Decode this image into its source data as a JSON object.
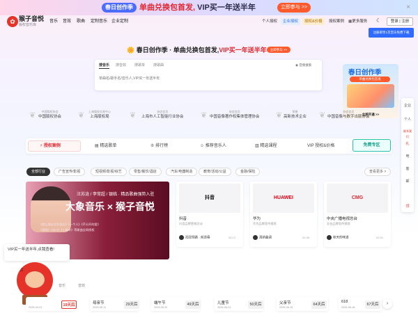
{
  "topbar": {
    "pill": "春日创作季",
    "main_red": "单曲兑换包首发,",
    "main_dark": "VIP买一年送半年",
    "btn": "立即参与 >>",
    "close": "×"
  },
  "nav": {
    "logo_title": "猴子音悦",
    "logo_sub": "版权音乐库",
    "links": [
      "音乐",
      "音效",
      "歌曲",
      "定制音乐",
      "企业定制"
    ],
    "right": [
      "个人授权",
      "企业授权",
      "授权&价格",
      "授权案例",
      "更多服务"
    ],
    "login": "登录 | 注册",
    "tooltip": "注册即享1次音乐免费下载"
  },
  "hero": {
    "title_a": "春日创作季 · 单曲兑换包首发,",
    "title_b": "VIP买一年送半年",
    "btn": "立即参与 >>"
  },
  "search": {
    "tabs": [
      "搜音乐",
      "搜音效",
      "搜歌单",
      "搜歌曲"
    ],
    "placeholder": "单曲名/歌手名/音乐人,VIP买一年送半年",
    "voice": "音频搜索"
  },
  "ad": {
    "title": "春日创作季",
    "sub": "单曲兑换包首发",
    "btn": "立即开通 >>"
  },
  "partners": [
    {
      "s": "中国版权协会",
      "m": "中国版权协会"
    },
    {
      "s": "上海版权交易中心",
      "m": "上海版权局"
    },
    {
      "s": "协会会员",
      "m": "上海市人工智能行业协会"
    },
    {
      "s": "协会会员",
      "m": "中国音像著作权集体管理协会"
    },
    {
      "s": "荣誉",
      "m": "高新技术企业"
    },
    {
      "s": "协会会员",
      "m": "中国音像与数字出版协会"
    }
  ],
  "features": [
    "授权案例",
    "精选歌单",
    "排行榜",
    "推荐音乐人",
    "精选课程",
    "VIP 授权&价格"
  ],
  "free_btn": "免费专区",
  "chips": [
    "全部行业",
    "广告宣传/影视",
    "短视频/影视/综艺",
    "零售/餐饮/酒店",
    "汽车/电器制造",
    "教育/活动/公益",
    "金融/保险"
  ],
  "more": "查看更多 >",
  "banner": {
    "t1": "汪苏泷 / 李常超 / 银临 · 精品歌曲强势入驻",
    "t2": "大象音乐 × 猴子音悦",
    "t3a": "《就让我走在你身边》《一个人》《不分开的爱》",
    "t3b": "《银临》《冰川》《小确幸》等歌曲全网授权"
  },
  "clients": [
    {
      "logo": "抖音",
      "name": "抖音",
      "sub": "抖音品牌营销活动",
      "play": "润润领路 · 前途春",
      "time": "00:13",
      "color": "#111"
    },
    {
      "logo": "HUAWEI",
      "name": "华为",
      "sub": "华为品牌宣传视频",
      "play": "清新曲调",
      "time": "00:38",
      "color": "#e60012"
    },
    {
      "logo": "CMG",
      "name": "中央广播电视总台",
      "sub": "总台品牌宣传视频",
      "play": "秋天的味道",
      "time": "02:51",
      "color": "#d7282f"
    }
  ],
  "rtools": [
    "企业",
    "个人",
    "联系我们",
    "礼",
    "电",
    "客",
    "邮",
    "顶"
  ],
  "chat": "VIP买一年送半年,点我查看!",
  "bottom_tabs": [
    "音乐",
    "音效"
  ],
  "bottom_cards": [
    {
      "t": "",
      "d": "2025-04-01",
      "n": "19天后",
      "on": true
    },
    {
      "t": "母亲节",
      "d": "2025-05-11",
      "n": "29天后",
      "on": false
    },
    {
      "t": "端午节",
      "d": "2025-05-31",
      "n": "49天后",
      "on": false
    },
    {
      "t": "儿童节",
      "d": "2025-06-01",
      "n": "50天后",
      "on": false
    },
    {
      "t": "父亲节",
      "d": "2025-06-15",
      "n": "64天后",
      "on": false
    },
    {
      "t": "618",
      "d": "2025-06-18",
      "n": "67天后",
      "on": false
    }
  ],
  "arrow": "›"
}
